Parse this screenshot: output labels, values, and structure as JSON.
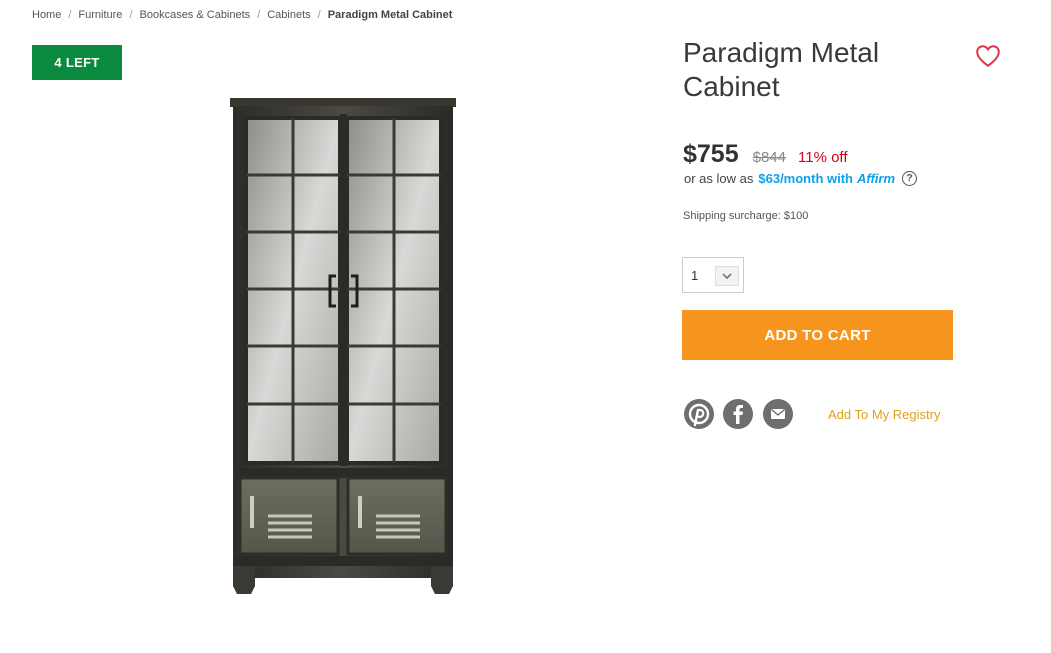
{
  "breadcrumb": {
    "items": [
      "Home",
      "Furniture",
      "Bookcases & Cabinets",
      "Cabinets"
    ],
    "separator": "/",
    "current": "Paradigm Metal Cabinet"
  },
  "stock_badge": "4 LEFT",
  "product": {
    "title": "Paradigm Metal Cabinet",
    "price": "$755",
    "original_price": "$844",
    "discount": "11% off",
    "image_icon": "metal-glass-door-cabinet"
  },
  "affirm": {
    "prefix": "or as low as",
    "monthly": "$63/month with",
    "brand": "Affirm",
    "help": "?"
  },
  "shipping": "Shipping surcharge: $100",
  "quantity": {
    "value": "1"
  },
  "cart_button": "ADD TO CART",
  "share": {
    "icons": [
      "pinterest-icon",
      "facebook-icon",
      "email-icon"
    ]
  },
  "registry_link": "Add To My Registry",
  "colors": {
    "badge": "#0a8a3e",
    "cart": "#f7941d",
    "discount": "#d0021b",
    "affirm": "#0fa0ea",
    "registry": "#e0a01b",
    "wishlist": "#e0334b"
  }
}
